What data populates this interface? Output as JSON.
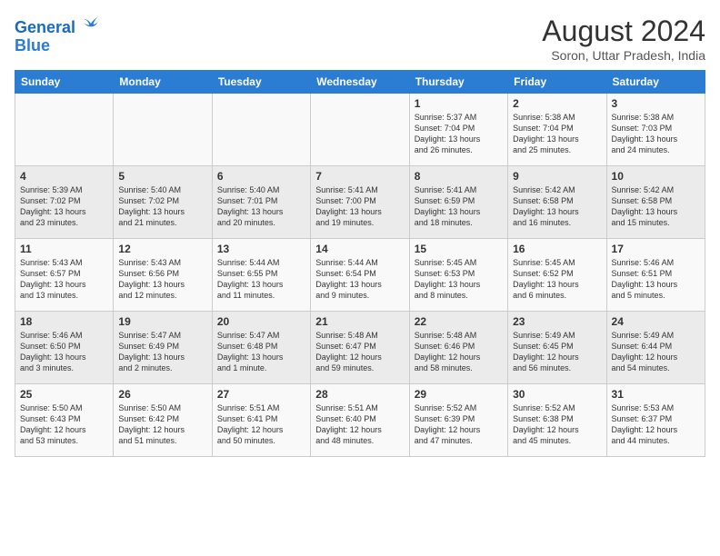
{
  "header": {
    "logo_line1": "General",
    "logo_line2": "Blue",
    "month_year": "August 2024",
    "location": "Soron, Uttar Pradesh, India"
  },
  "days_of_week": [
    "Sunday",
    "Monday",
    "Tuesday",
    "Wednesday",
    "Thursday",
    "Friday",
    "Saturday"
  ],
  "weeks": [
    [
      {
        "day": "",
        "info": ""
      },
      {
        "day": "",
        "info": ""
      },
      {
        "day": "",
        "info": ""
      },
      {
        "day": "",
        "info": ""
      },
      {
        "day": "1",
        "info": "Sunrise: 5:37 AM\nSunset: 7:04 PM\nDaylight: 13 hours\nand 26 minutes."
      },
      {
        "day": "2",
        "info": "Sunrise: 5:38 AM\nSunset: 7:04 PM\nDaylight: 13 hours\nand 25 minutes."
      },
      {
        "day": "3",
        "info": "Sunrise: 5:38 AM\nSunset: 7:03 PM\nDaylight: 13 hours\nand 24 minutes."
      }
    ],
    [
      {
        "day": "4",
        "info": "Sunrise: 5:39 AM\nSunset: 7:02 PM\nDaylight: 13 hours\nand 23 minutes."
      },
      {
        "day": "5",
        "info": "Sunrise: 5:40 AM\nSunset: 7:02 PM\nDaylight: 13 hours\nand 21 minutes."
      },
      {
        "day": "6",
        "info": "Sunrise: 5:40 AM\nSunset: 7:01 PM\nDaylight: 13 hours\nand 20 minutes."
      },
      {
        "day": "7",
        "info": "Sunrise: 5:41 AM\nSunset: 7:00 PM\nDaylight: 13 hours\nand 19 minutes."
      },
      {
        "day": "8",
        "info": "Sunrise: 5:41 AM\nSunset: 6:59 PM\nDaylight: 13 hours\nand 18 minutes."
      },
      {
        "day": "9",
        "info": "Sunrise: 5:42 AM\nSunset: 6:58 PM\nDaylight: 13 hours\nand 16 minutes."
      },
      {
        "day": "10",
        "info": "Sunrise: 5:42 AM\nSunset: 6:58 PM\nDaylight: 13 hours\nand 15 minutes."
      }
    ],
    [
      {
        "day": "11",
        "info": "Sunrise: 5:43 AM\nSunset: 6:57 PM\nDaylight: 13 hours\nand 13 minutes."
      },
      {
        "day": "12",
        "info": "Sunrise: 5:43 AM\nSunset: 6:56 PM\nDaylight: 13 hours\nand 12 minutes."
      },
      {
        "day": "13",
        "info": "Sunrise: 5:44 AM\nSunset: 6:55 PM\nDaylight: 13 hours\nand 11 minutes."
      },
      {
        "day": "14",
        "info": "Sunrise: 5:44 AM\nSunset: 6:54 PM\nDaylight: 13 hours\nand 9 minutes."
      },
      {
        "day": "15",
        "info": "Sunrise: 5:45 AM\nSunset: 6:53 PM\nDaylight: 13 hours\nand 8 minutes."
      },
      {
        "day": "16",
        "info": "Sunrise: 5:45 AM\nSunset: 6:52 PM\nDaylight: 13 hours\nand 6 minutes."
      },
      {
        "day": "17",
        "info": "Sunrise: 5:46 AM\nSunset: 6:51 PM\nDaylight: 13 hours\nand 5 minutes."
      }
    ],
    [
      {
        "day": "18",
        "info": "Sunrise: 5:46 AM\nSunset: 6:50 PM\nDaylight: 13 hours\nand 3 minutes."
      },
      {
        "day": "19",
        "info": "Sunrise: 5:47 AM\nSunset: 6:49 PM\nDaylight: 13 hours\nand 2 minutes."
      },
      {
        "day": "20",
        "info": "Sunrise: 5:47 AM\nSunset: 6:48 PM\nDaylight: 13 hours\nand 1 minute."
      },
      {
        "day": "21",
        "info": "Sunrise: 5:48 AM\nSunset: 6:47 PM\nDaylight: 12 hours\nand 59 minutes."
      },
      {
        "day": "22",
        "info": "Sunrise: 5:48 AM\nSunset: 6:46 PM\nDaylight: 12 hours\nand 58 minutes."
      },
      {
        "day": "23",
        "info": "Sunrise: 5:49 AM\nSunset: 6:45 PM\nDaylight: 12 hours\nand 56 minutes."
      },
      {
        "day": "24",
        "info": "Sunrise: 5:49 AM\nSunset: 6:44 PM\nDaylight: 12 hours\nand 54 minutes."
      }
    ],
    [
      {
        "day": "25",
        "info": "Sunrise: 5:50 AM\nSunset: 6:43 PM\nDaylight: 12 hours\nand 53 minutes."
      },
      {
        "day": "26",
        "info": "Sunrise: 5:50 AM\nSunset: 6:42 PM\nDaylight: 12 hours\nand 51 minutes."
      },
      {
        "day": "27",
        "info": "Sunrise: 5:51 AM\nSunset: 6:41 PM\nDaylight: 12 hours\nand 50 minutes."
      },
      {
        "day": "28",
        "info": "Sunrise: 5:51 AM\nSunset: 6:40 PM\nDaylight: 12 hours\nand 48 minutes."
      },
      {
        "day": "29",
        "info": "Sunrise: 5:52 AM\nSunset: 6:39 PM\nDaylight: 12 hours\nand 47 minutes."
      },
      {
        "day": "30",
        "info": "Sunrise: 5:52 AM\nSunset: 6:38 PM\nDaylight: 12 hours\nand 45 minutes."
      },
      {
        "day": "31",
        "info": "Sunrise: 5:53 AM\nSunset: 6:37 PM\nDaylight: 12 hours\nand 44 minutes."
      }
    ]
  ]
}
